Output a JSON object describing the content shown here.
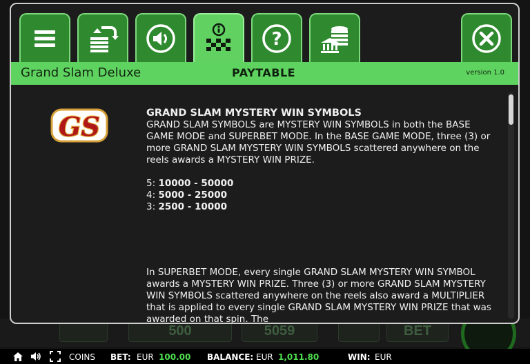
{
  "game_title": "Grand Slam Deluxe",
  "header_title": "PAYTABLE",
  "version": "version 1.0",
  "tabs": [
    {
      "icon": "menu-icon"
    },
    {
      "icon": "autoplay-icon"
    },
    {
      "icon": "sound-icon"
    },
    {
      "icon": "paytable-info-icon",
      "active": true
    },
    {
      "icon": "help-icon"
    },
    {
      "icon": "bet-coins-icon"
    },
    {
      "icon": "close-icon"
    }
  ],
  "logo_text": "GS",
  "section": {
    "heading": "GRAND SLAM MYSTERY WIN SYMBOLS",
    "para1": "GRAND SLAM SYMBOLS are MYSTERY WIN SYMBOLS in both the BASE GAME MODE and SUPERBET MODE. In the BASE GAME MODE, three (3) or more GRAND SLAM MYSTERY WIN SYMBOLS scattered anywhere on the reels awards a MYSTERY WIN PRIZE.",
    "pays": [
      {
        "count": "5:",
        "range": "10000 - 50000"
      },
      {
        "count": "4:",
        "range": "5000 - 25000"
      },
      {
        "count": "3:",
        "range": "2500 - 10000"
      }
    ],
    "para2": "In SUPERBET MODE, every single GRAND SLAM MYSTERY WIN SYMBOL awards a MYSTERY WIN PRIZE. Three (3) or more GRAND SLAM MYSTERY WIN SYMBOLS scattered anywhere on the reels also award a MULTIPLIER that is applied to every single GRAND SLAM MYSTERY WIN PRIZE that was awarded on that spin. The"
  },
  "background": {
    "value_a": "500",
    "value_b": "5059",
    "bet_label": "BET"
  },
  "status_bar": {
    "coins_label": "COINS",
    "bet_label": "BET:",
    "bet_currency": "EUR",
    "bet_value": "100.00",
    "balance_label": "BALANCE:",
    "balance_currency": "EUR",
    "balance_value": "1,011.80",
    "win_label": "WIN:",
    "win_currency": "EUR"
  },
  "colors": {
    "accent_green": "#5fd35f",
    "tab_green": "#2f8a2f",
    "value_green": "#4ee04e",
    "panel_bg": "#1c1c1c"
  }
}
